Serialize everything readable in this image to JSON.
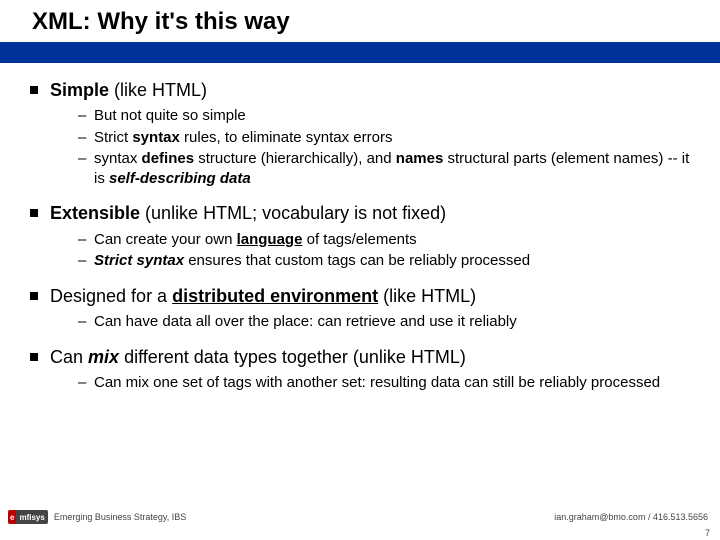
{
  "title": "XML: Why it's this way",
  "bullets": [
    {
      "head_html": "<b>Simple</b> (like HTML)",
      "subs": [
        "But not quite so simple",
        "Strict <b>syntax</b> rules, to eliminate syntax errors",
        "syntax <b>defines</b> structure (hierarchically), and <b>names</b> structural parts (element names) -- it is <b><i>self-describing data</i></b>"
      ]
    },
    {
      "head_html": "<b>Extensible</b> (unlike HTML; vocabulary is not fixed)",
      "subs": [
        "Can create your own <b><u>language</u></b> of tags/elements",
        "<b><i>Strict syntax</i></b> ensures that custom tags can be reliably processed"
      ]
    },
    {
      "head_html": "Designed for a <b><u>distributed environment</u></b>  (like HTML)",
      "subs": [
        "Can have data all over the place: can retrieve and use it reliably"
      ]
    },
    {
      "head_html": "Can <b><i>mix</i></b>  different data types together  (unlike HTML)",
      "subs": [
        "Can mix one set of tags with another set: resulting data can still be reliably processed"
      ]
    }
  ],
  "footer": {
    "left": "Emerging Business Strategy, IBS",
    "right": "ian.graham@bmo.com / 416.513.5656",
    "logo_a": "e",
    "logo_b": "mfisys"
  },
  "page_number": "7"
}
